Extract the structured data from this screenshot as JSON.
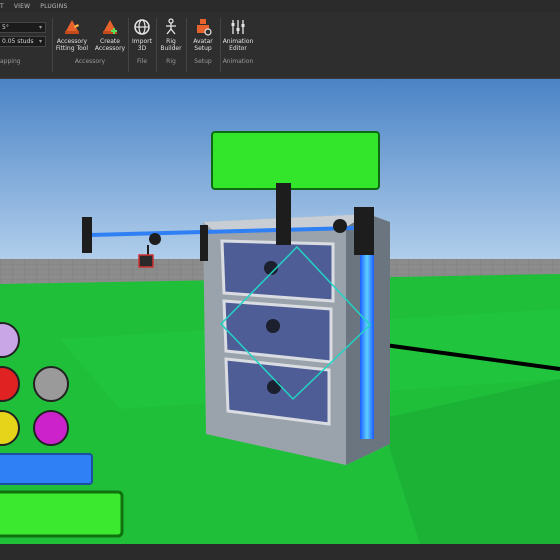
{
  "menubar": {
    "items": [
      "T",
      "VIEW",
      "PLUGINS"
    ]
  },
  "snap": {
    "rotate_value": "5°",
    "move_value": "0.05 studs",
    "group_label": "apping"
  },
  "tools": [
    {
      "label_line1": "Accessory",
      "label_line2": "Fitting Tool",
      "icon": "accessory-fitting-tool-icon"
    },
    {
      "label_line1": "Create",
      "label_line2": "Accessory",
      "icon": "create-accessory-icon"
    },
    {
      "label_line1": "Import",
      "label_line2": "3D",
      "icon": "import-3d-icon"
    },
    {
      "label_line1": "Rig",
      "label_line2": "Builder",
      "icon": "rig-builder-icon"
    },
    {
      "label_line1": "Avatar",
      "label_line2": "Setup",
      "icon": "avatar-setup-icon"
    },
    {
      "label_line1": "Animation",
      "label_line2": "Editor",
      "icon": "animation-editor-icon"
    }
  ],
  "groups": {
    "accessory": "Accessory",
    "file": "File",
    "rig": "Rig",
    "setup": "Setup",
    "animation": "Animation"
  },
  "colors": {
    "sky_top": "#4f86c8",
    "sky_bottom": "#b9d3ee",
    "ground": "#1fbf3a",
    "highlight_green": "#33e62b",
    "handle_blue": "#2f7ff5",
    "selection_cyan": "#22d3c5",
    "neon_strip": "#29a3ff"
  },
  "swatches": [
    "lavender",
    "red",
    "gray",
    "yellow",
    "magenta"
  ]
}
